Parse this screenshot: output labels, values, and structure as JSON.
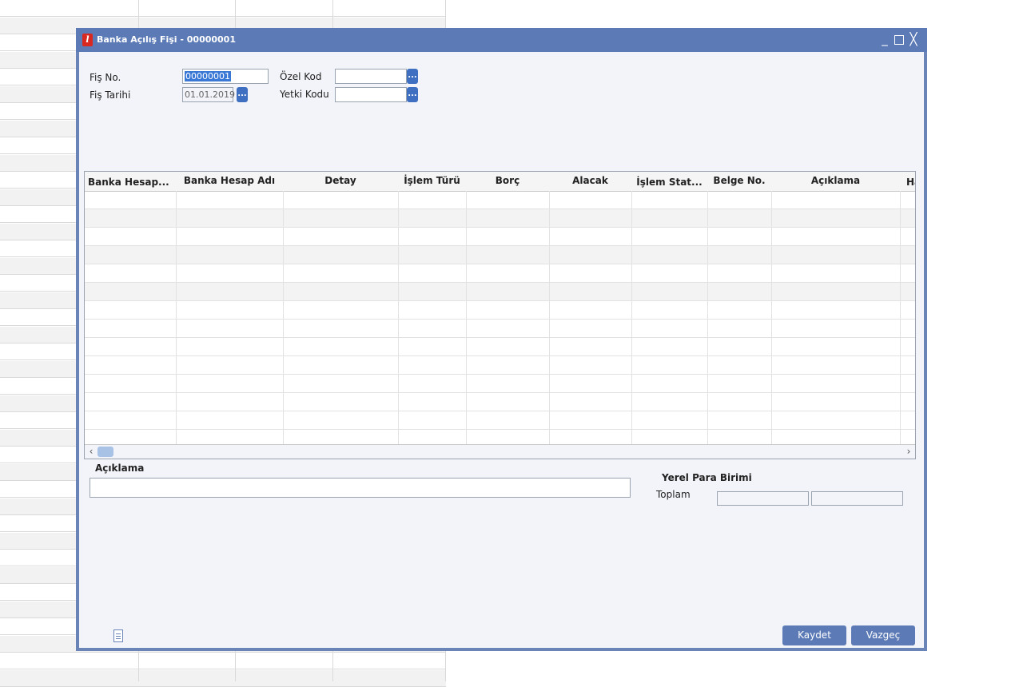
{
  "window": {
    "title": "Banka Açılış Fişi - 00000001",
    "controls": {
      "minimize": "_",
      "close": "╳"
    }
  },
  "form": {
    "fis_no": {
      "label": "Fiş No.",
      "value": "00000001"
    },
    "fis_tarihi": {
      "label": "Fiş Tarihi",
      "value": "01.01.2019"
    },
    "ozel_kod": {
      "label": "Özel Kod",
      "value": ""
    },
    "yetki_kodu": {
      "label": "Yetki Kodu",
      "value": ""
    },
    "lookup_button_label": "..."
  },
  "grid": {
    "columns": [
      "Banka Hesap...",
      "Banka Hesap Adı",
      "Detay",
      "İşlem Türü",
      "Borç",
      "Alacak",
      "İşlem Stat...",
      "Belge No.",
      "Açıklama",
      "Ha"
    ],
    "scroll": {
      "left_arrow": "‹",
      "right_arrow": "›"
    }
  },
  "aciklama": {
    "label": "Açıklama",
    "value": ""
  },
  "totals": {
    "heading": "Yerel Para Birimi",
    "toplam_label": "Toplam",
    "borc": "",
    "alacak": ""
  },
  "buttons": {
    "save": "Kaydet",
    "cancel": "Vazgeç"
  }
}
